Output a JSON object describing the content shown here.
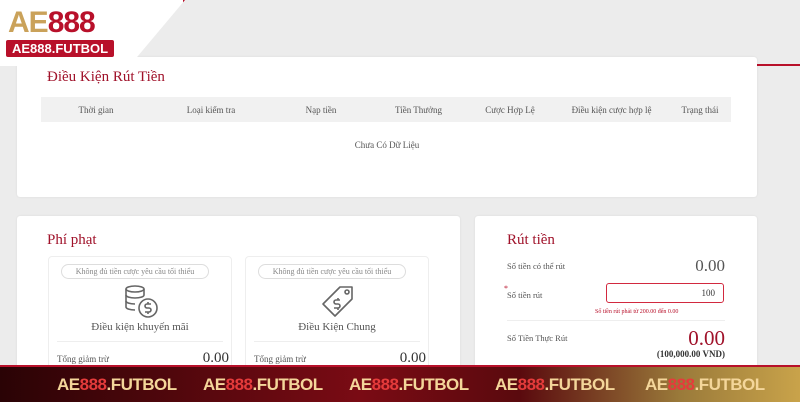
{
  "logo": {
    "brand_a": "AE",
    "brand_b": "888",
    "domain": "AE888.FUTBOL"
  },
  "conditions": {
    "title": "Điều Kiện Rút Tiền",
    "columns": [
      "Thời gian",
      "Loại kiểm tra",
      "Nạp tiền",
      "Tiền Thưởng",
      "Cược Hợp Lệ",
      "Điều kiện cược hợp lệ",
      "Trạng thái"
    ],
    "empty_text": "Chưa Có Dữ Liệu"
  },
  "penalty": {
    "title": "Phí phạt",
    "panels": [
      {
        "notice": "Không đủ tiền cược yêu cầu tối thiểu",
        "label": "Điều kiện khuyến mãi",
        "total_label": "Tổng giảm trừ",
        "total_value": "0.00",
        "icon": "coins-dollar-icon"
      },
      {
        "notice": "Không đủ tiền cược yêu cầu tối thiểu",
        "label": "Điều Kiện Chung",
        "total_label": "Tổng giảm trừ",
        "total_value": "0.00",
        "icon": "dollar-tag-icon"
      }
    ]
  },
  "withdraw": {
    "title": "Rút tiền",
    "available_label": "Số tiền có thể rút",
    "available_value": "0.00",
    "amount_label": "Số tiền rút",
    "amount_value": "100",
    "amount_note": "Số tiền rút phải từ 200.00 đến 0.00",
    "actual_label": "Số Tiền Thực Rút",
    "actual_value": "0.00",
    "actual_vnd": "(100,000.00 VND)"
  },
  "footer": {
    "brand_a": "AE",
    "brand_b": "888",
    "brand_c": ".FUTBOL"
  },
  "colors": {
    "accent": "#a0122a",
    "brand_red": "#b8102a",
    "gold": "#caa25a"
  }
}
